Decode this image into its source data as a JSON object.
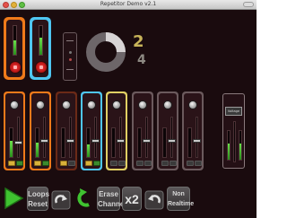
{
  "window": {
    "title": "Repetitor Demo v2.1"
  },
  "loops": [
    {
      "color": "#f07a1a",
      "level": 0.5
    },
    {
      "color": "#4fc6f2",
      "level": 0.6
    }
  ],
  "counter": {
    "current": "2",
    "total": "4",
    "progress": 0.25
  },
  "channels": [
    {
      "border": "#f07a1a",
      "knob": true,
      "level": 0.55,
      "fader": 0.35,
      "left_btn": "on",
      "right_btn": "green"
    },
    {
      "border": "#f07a1a",
      "knob": true,
      "level": 0.5,
      "fader": 0.4,
      "left_btn": "on",
      "right_btn": "green"
    },
    {
      "border": "#6b2a17",
      "knob": true,
      "level": 0.0,
      "fader": 0.4,
      "left_btn": "on",
      "right_btn": "off"
    },
    {
      "border": "#4fc6f2",
      "knob": true,
      "level": 0.45,
      "fader": 0.4,
      "left_btn": "on",
      "right_btn": "green"
    },
    {
      "border": "#e0cf63",
      "knob": true,
      "level": 0.0,
      "fader": 0.4,
      "left_btn": "off",
      "right_btn": "off"
    },
    {
      "border": "#6b5a5d",
      "knob": true,
      "level": 0.0,
      "fader": 0.4,
      "left_btn": "off",
      "right_btn": "off"
    },
    {
      "border": "#6b5a5d",
      "knob": true,
      "level": 0.0,
      "fader": 0.4,
      "left_btn": "off",
      "right_btn": "off"
    },
    {
      "border": "#6b5a5d",
      "knob": true,
      "level": 0.0,
      "fader": 0.4,
      "left_btn": "off",
      "right_btn": "off"
    }
  ],
  "master": {
    "label": "Voltage",
    "left_level": 0.55,
    "right_level": 0.55
  },
  "toolbar": {
    "play_color": "#3fc230",
    "loops_reset": "Loops Reset",
    "erase_channel": "Erase Channel",
    "x2": "x2",
    "non_realtime": "Non Realtime"
  }
}
